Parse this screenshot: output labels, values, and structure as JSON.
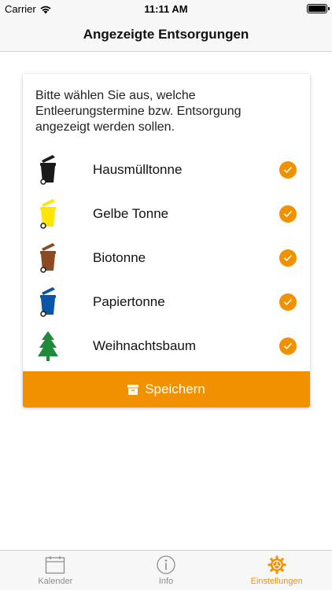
{
  "status_bar": {
    "carrier": "Carrier",
    "time": "11:11 AM"
  },
  "nav": {
    "title": "Angezeigte Entsorgungen"
  },
  "card": {
    "intro": "Bitte wählen Sie aus, welche Entleerungstermine bzw. Entsorgung angezeigt werden sollen.",
    "options": [
      {
        "label": "Hausmülltonne",
        "icon": "black-bin-icon",
        "color": "#1a1a1a",
        "checked": true
      },
      {
        "label": "Gelbe Tonne",
        "icon": "yellow-bin-icon",
        "color": "#ffe600",
        "checked": true
      },
      {
        "label": "Biotonne",
        "icon": "brown-bin-icon",
        "color": "#8b4a22",
        "checked": true
      },
      {
        "label": "Papiertonne",
        "icon": "blue-bin-icon",
        "color": "#0a55a6",
        "checked": true
      },
      {
        "label": "Weihnachtsbaum",
        "icon": "christmas-tree-icon",
        "color": "#1f8a3a",
        "checked": true
      }
    ],
    "save_label": "Speichern"
  },
  "tabs": [
    {
      "label": "Kalender",
      "icon": "calendar-icon",
      "active": false
    },
    {
      "label": "Info",
      "icon": "info-icon",
      "active": false
    },
    {
      "label": "Einstellungen",
      "icon": "settings-gear-icon",
      "active": true
    }
  ],
  "colors": {
    "accent": "#f29100"
  }
}
